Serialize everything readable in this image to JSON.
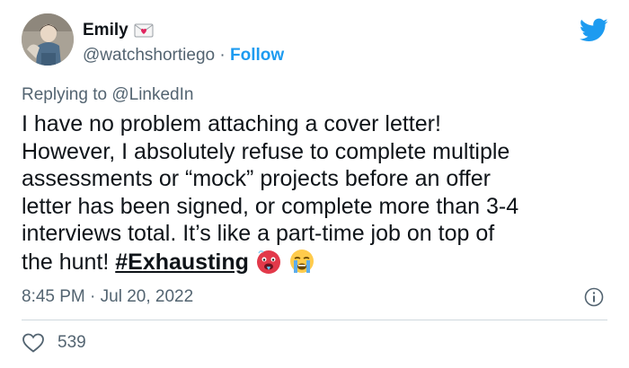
{
  "author": {
    "name": "Emily",
    "name_emoji_icon": "love-letter-icon",
    "handle": "@watchshortiego",
    "separator": " · ",
    "follow_label": "Follow"
  },
  "reply": {
    "prefix": "Replying to ",
    "mention": "@LinkedIn"
  },
  "tweet": {
    "line1": "I have no problem attaching a cover letter!",
    "line2": "However, I absolutely refuse to complete multiple",
    "line3": "assessments or “mock” projects before an offer",
    "line4": "letter has been signed, or complete more than 3-4",
    "line5": "interviews total. It’s like a part-time job on top of",
    "line6_prefix": "the hunt! ",
    "hashtag": "#Exhausting",
    "emoji_icons": [
      "hot-face-icon",
      "crying-face-icon"
    ]
  },
  "meta": {
    "time": "8:45 PM",
    "separator": " · ",
    "date": "Jul 20, 2022"
  },
  "engagement": {
    "likes": "539"
  },
  "colors": {
    "accent": "#1d9bf0",
    "text": "#0f1419",
    "secondary": "#536471",
    "divider": "#cfd9de",
    "like_icon": "#536471"
  }
}
